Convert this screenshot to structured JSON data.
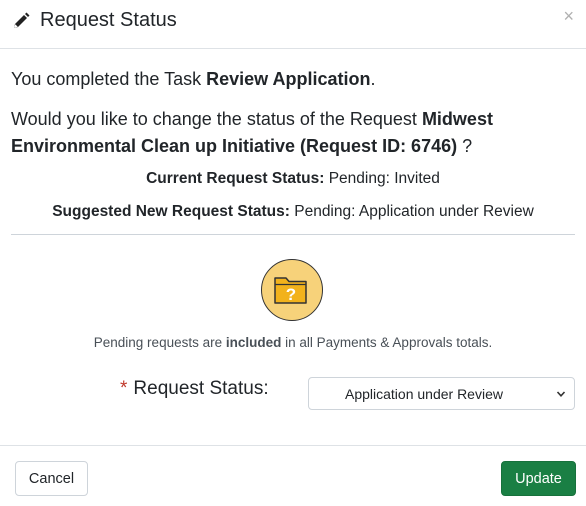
{
  "dialog": {
    "title": "Request Status",
    "close_glyph": "×"
  },
  "body": {
    "completed_prefix": "You completed the Task ",
    "task_name": "Review Application",
    "completed_suffix": ".",
    "question_prefix": "Would you like to change the status of the Request ",
    "request_name": "Midwest Environmental Clean up Initiative (Request ID: 6746)",
    "question_suffix": " ?",
    "current_label": "Current Request Status:",
    "current_value": "Pending: Invited",
    "suggested_label": "Suggested New Request Status:",
    "suggested_value": "Pending: Application under Review",
    "icon_glyph": "?",
    "note_prefix": "Pending requests are ",
    "note_bold": "included",
    "note_suffix": " in all Payments & Approvals totals."
  },
  "form": {
    "required_mark": "*",
    "status_label": "Request Status:",
    "status_selected": "Application under Review"
  },
  "footer": {
    "cancel_label": "Cancel",
    "update_label": "Update"
  },
  "colors": {
    "update_bg": "#1a7f44",
    "required": "#c0392b",
    "icon_fill": "#f7d27a"
  },
  "icons": {
    "title_icon": "pencil-icon",
    "status_icon": "folder-question-icon",
    "select_icon": "chevron-down-icon"
  }
}
